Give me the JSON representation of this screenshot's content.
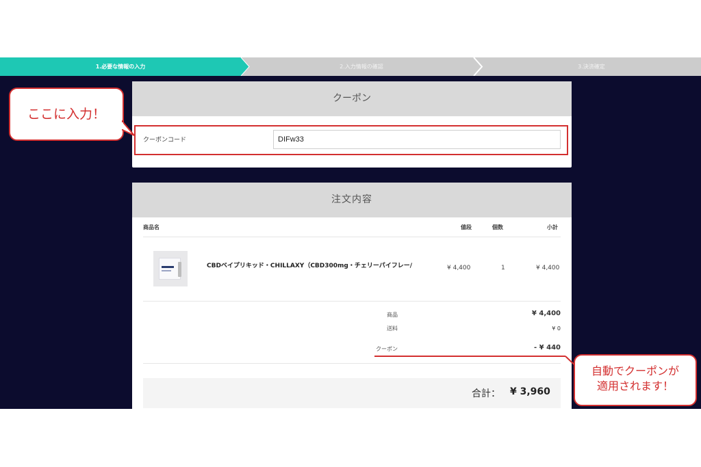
{
  "steps": [
    {
      "label": "1.必要な情報の入力",
      "active": true
    },
    {
      "label": "2.入力情報の確認",
      "active": false
    },
    {
      "label": "3.決済確定",
      "active": false
    }
  ],
  "colors": {
    "background": "#0c0c2e",
    "active_step": "#1ec8b4",
    "inactive_step": "#cccccc",
    "annotation": "#d32f2f",
    "panel_header": "#d9d9d9"
  },
  "coupon": {
    "title": "クーポン",
    "label": "クーポンコード",
    "value": "DIFw33"
  },
  "order": {
    "title": "注文内容",
    "headers": {
      "name": "商品名",
      "price": "値段",
      "qty": "個数",
      "subtotal": "小計"
    },
    "items": [
      {
        "name": "CBDベイプリキッド・CHILLAXY（CBD300mg・チェリーパイフレー/",
        "price": "¥ 4,400",
        "qty": "1",
        "subtotal": "¥ 4,400",
        "image": "product-thumbnail"
      }
    ],
    "summary": {
      "goods_label": "商品",
      "goods_value": "¥ 4,400",
      "shipping_label": "送料",
      "shipping_value": "¥ 0",
      "coupon_label": "クーポン",
      "coupon_value": "- ¥ 440"
    },
    "total_label": "合計：",
    "total_value": "¥ 3,960"
  },
  "annotations": {
    "left": "ここに入力！",
    "right_line1": "自動でクーポンが",
    "right_line2": "適用されます！"
  }
}
